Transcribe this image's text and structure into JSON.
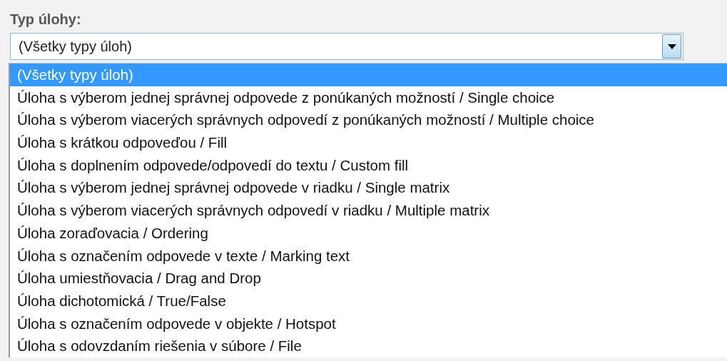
{
  "field": {
    "label": "Typ úlohy:",
    "value": "(Všetky typy úloh)",
    "expanded": true
  },
  "options": [
    {
      "label": "(Všetky typy úloh)",
      "selected": true
    },
    {
      "label": "Úloha s výberom jednej správnej odpovede z ponúkaných možností / Single choice",
      "selected": false
    },
    {
      "label": "Úloha s výberom viacerých správnych odpovedí z ponúkaných možností / Multiple choice",
      "selected": false
    },
    {
      "label": "Úloha s krátkou odpoveďou / Fill",
      "selected": false
    },
    {
      "label": "Úloha s doplnením odpovede/odpovedí do textu / Custom fill",
      "selected": false
    },
    {
      "label": "Úloha s výberom jednej správnej odpovede v riadku / Single matrix",
      "selected": false
    },
    {
      "label": "Úloha s výberom viacerých správnych odpovedí v riadku / Multiple matrix",
      "selected": false
    },
    {
      "label": "Úloha zoraďovacia / Ordering",
      "selected": false
    },
    {
      "label": "Úloha s označením odpovede v texte / Marking text",
      "selected": false
    },
    {
      "label": "Úloha umiestňovacia / Drag and Drop",
      "selected": false
    },
    {
      "label": "Úloha dichotomická / True/False",
      "selected": false
    },
    {
      "label": "Úloha s označením odpovede v objekte / Hotspot",
      "selected": false
    },
    {
      "label": "Úloha s odovzdaním riešenia v súbore / File",
      "selected": false
    }
  ]
}
